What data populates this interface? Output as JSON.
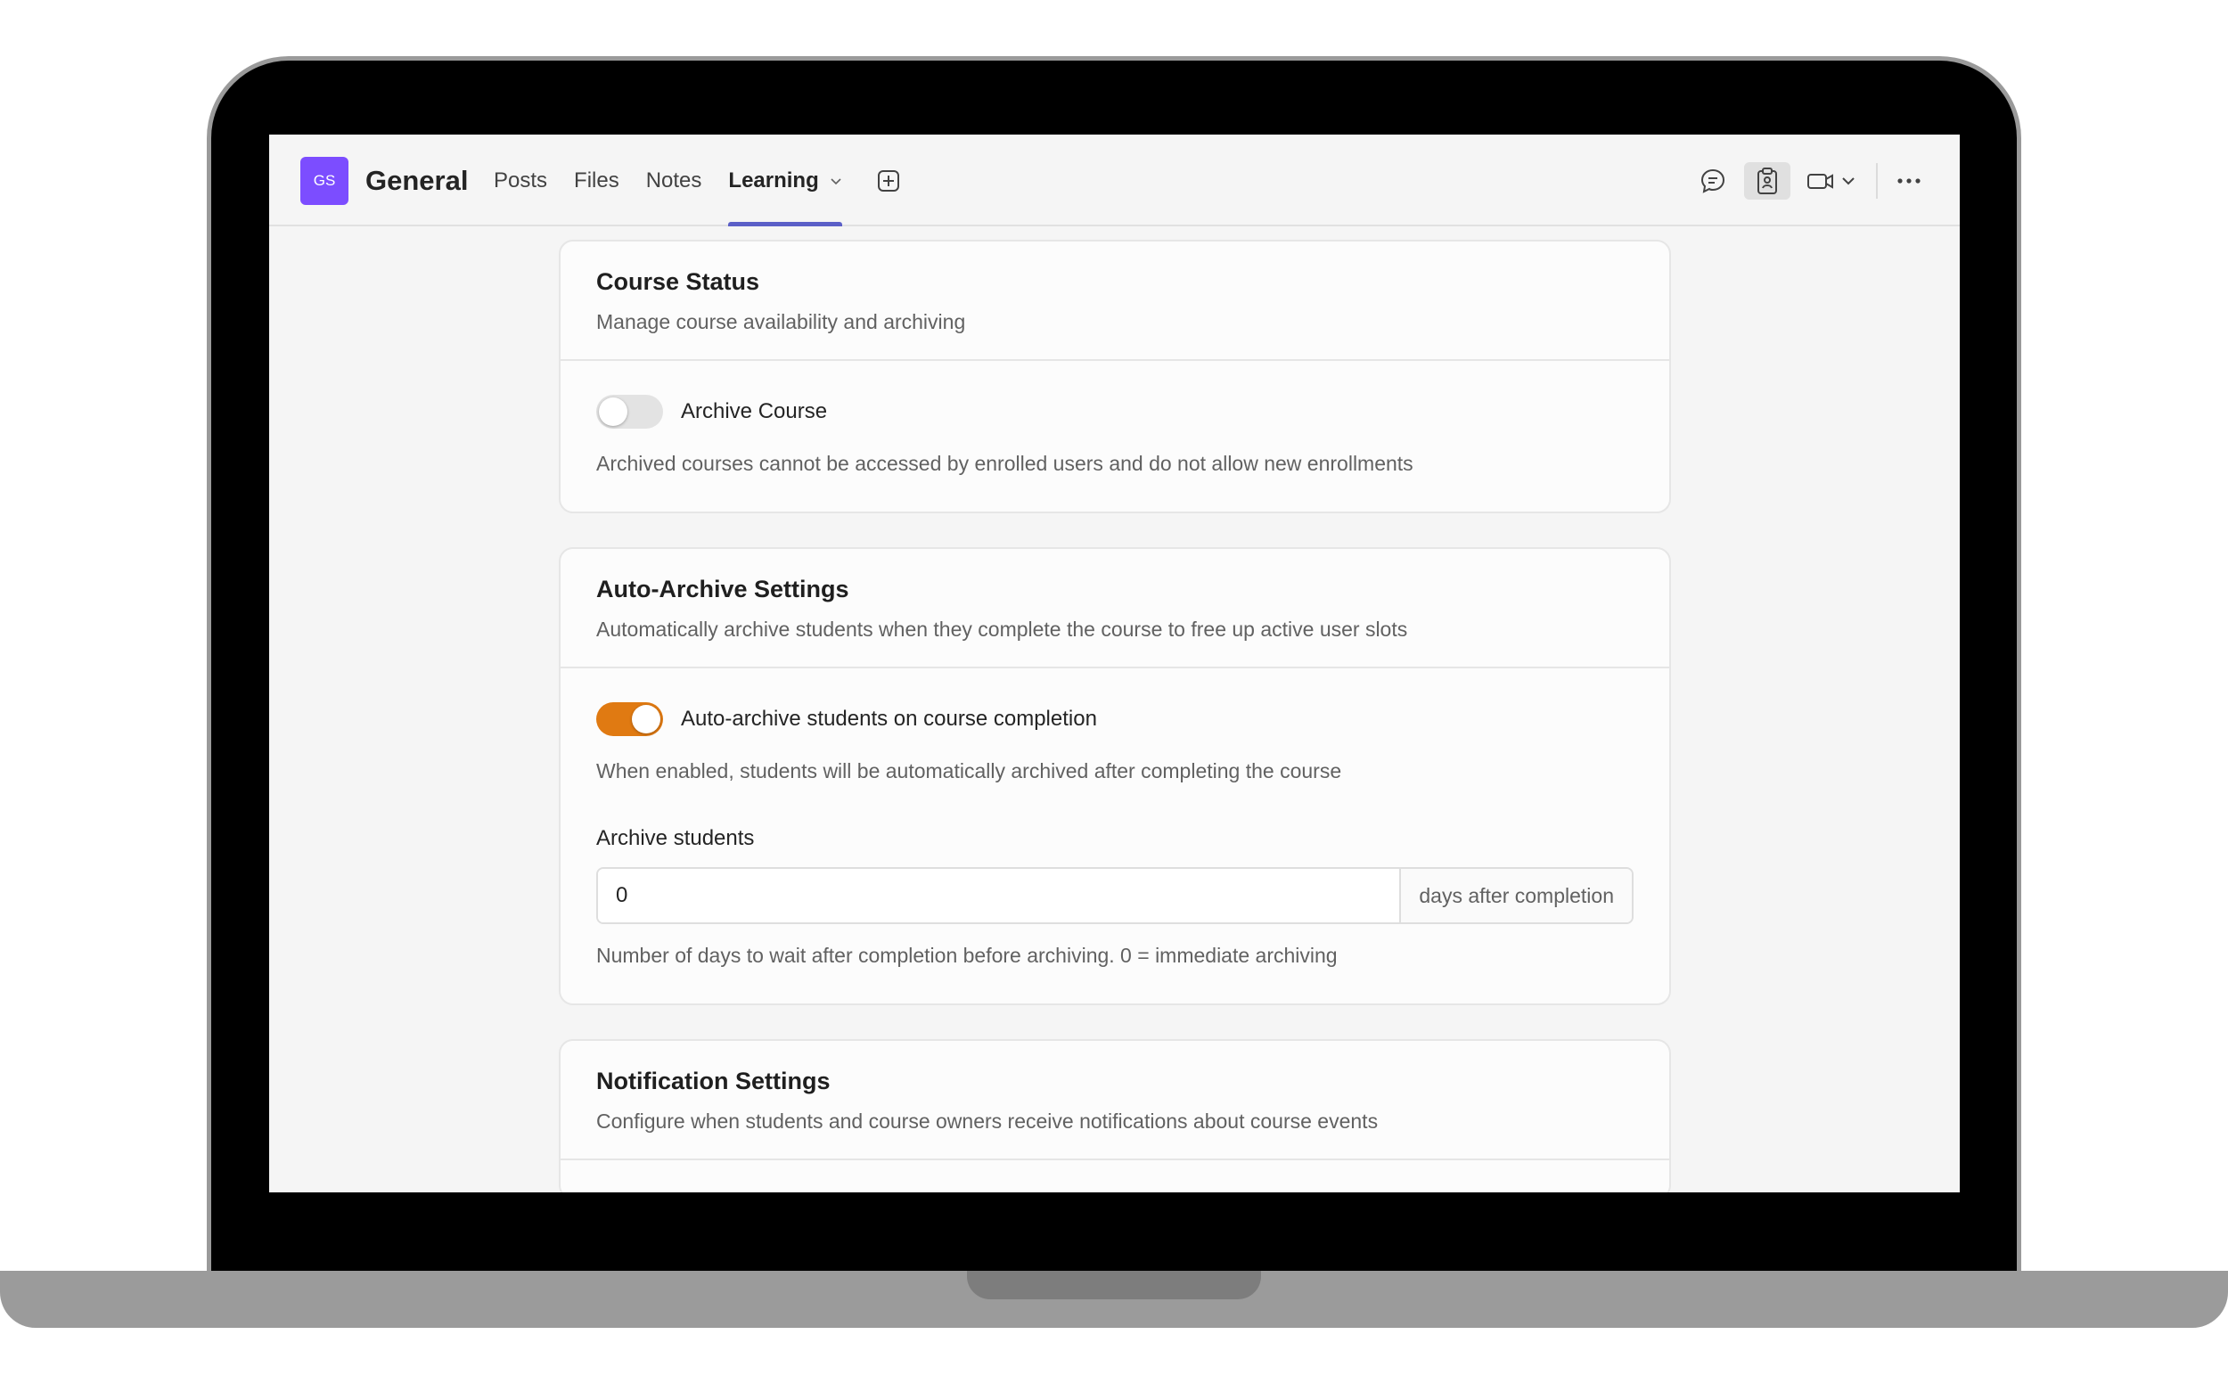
{
  "header": {
    "avatar_initials": "GS",
    "team_name": "General",
    "tabs": [
      {
        "label": "Posts"
      },
      {
        "label": "Files"
      },
      {
        "label": "Notes"
      },
      {
        "label": "Learning",
        "active": true
      }
    ],
    "accent": "#5b5fc7",
    "avatar_color": "#7c4dff"
  },
  "course_status": {
    "title": "Course Status",
    "description": "Manage course availability and archiving",
    "archive_toggle_label": "Archive Course",
    "archive_toggle_on": false,
    "archive_hint": "Archived courses cannot be accessed by enrolled users and do not allow new enrollments"
  },
  "auto_archive": {
    "title": "Auto-Archive Settings",
    "description": "Automatically archive students when they complete the course to free up active user slots",
    "toggle_label": "Auto-archive students on course completion",
    "toggle_on": true,
    "toggle_hint": "When enabled, students will be automatically archived after completing the course",
    "field_label": "Archive students",
    "field_value": "0",
    "field_suffix": "days after completion",
    "field_hint": "Number of days to wait after completion before archiving. 0 = immediate archiving",
    "toggle_color": "#e07a12"
  },
  "notifications": {
    "title": "Notification Settings",
    "description": "Configure when students and course owners receive notifications about course events"
  }
}
